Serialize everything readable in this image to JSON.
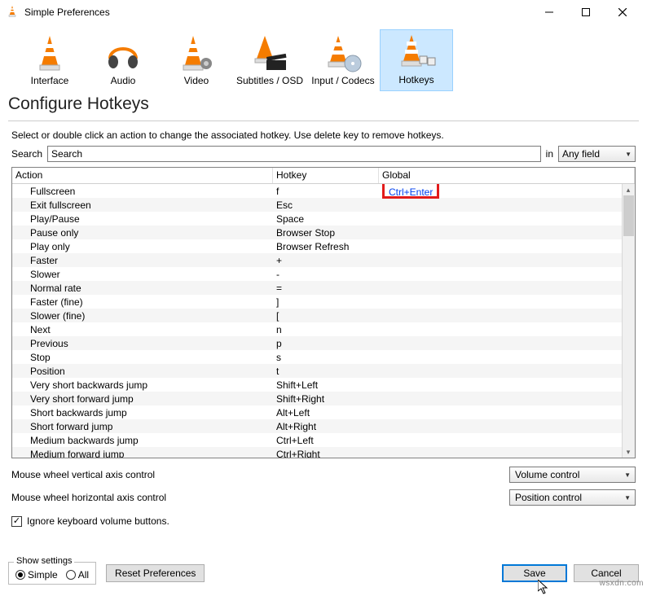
{
  "window": {
    "title": "Simple Preferences"
  },
  "categories": [
    {
      "label": "Interface"
    },
    {
      "label": "Audio"
    },
    {
      "label": "Video"
    },
    {
      "label": "Subtitles / OSD"
    },
    {
      "label": "Input / Codecs"
    },
    {
      "label": "Hotkeys"
    }
  ],
  "selected_category_index": 5,
  "heading": "Configure Hotkeys",
  "help_text": "Select or double click an action to change the associated hotkey. Use delete key to remove hotkeys.",
  "search": {
    "label": "Search",
    "value": "Search",
    "in_label": "in",
    "field": "Any field"
  },
  "columns": {
    "action": "Action",
    "hotkey": "Hotkey",
    "global": "Global"
  },
  "rows": [
    {
      "action": "Fullscreen",
      "hotkey": "f",
      "global": "Ctrl+Enter",
      "highlight_global": true
    },
    {
      "action": "Exit fullscreen",
      "hotkey": "Esc",
      "global": ""
    },
    {
      "action": "Play/Pause",
      "hotkey": "Space",
      "global": ""
    },
    {
      "action": "Pause only",
      "hotkey": "Browser Stop",
      "global": ""
    },
    {
      "action": "Play only",
      "hotkey": "Browser Refresh",
      "global": ""
    },
    {
      "action": "Faster",
      "hotkey": "+",
      "global": ""
    },
    {
      "action": "Slower",
      "hotkey": "-",
      "global": ""
    },
    {
      "action": "Normal rate",
      "hotkey": "=",
      "global": ""
    },
    {
      "action": "Faster (fine)",
      "hotkey": "]",
      "global": ""
    },
    {
      "action": "Slower (fine)",
      "hotkey": "[",
      "global": ""
    },
    {
      "action": "Next",
      "hotkey": "n",
      "global": ""
    },
    {
      "action": "Previous",
      "hotkey": "p",
      "global": ""
    },
    {
      "action": "Stop",
      "hotkey": "s",
      "global": ""
    },
    {
      "action": "Position",
      "hotkey": "t",
      "global": ""
    },
    {
      "action": "Very short backwards jump",
      "hotkey": "Shift+Left",
      "global": ""
    },
    {
      "action": "Very short forward jump",
      "hotkey": "Shift+Right",
      "global": ""
    },
    {
      "action": "Short backwards jump",
      "hotkey": "Alt+Left",
      "global": ""
    },
    {
      "action": "Short forward jump",
      "hotkey": "Alt+Right",
      "global": ""
    },
    {
      "action": "Medium backwards jump",
      "hotkey": "Ctrl+Left",
      "global": ""
    },
    {
      "action": "Medium forward jump",
      "hotkey": "Ctrl+Right",
      "global": ""
    }
  ],
  "mouse": {
    "vertical_label": "Mouse wheel vertical axis control",
    "vertical_value": "Volume control",
    "horizontal_label": "Mouse wheel horizontal axis control",
    "horizontal_value": "Position control",
    "ignore_kb_label": "Ignore keyboard volume buttons.",
    "ignore_kb_checked": true
  },
  "footer": {
    "show_settings_legend": "Show settings",
    "simple_label": "Simple",
    "all_label": "All",
    "selected_mode": "simple",
    "reset_label": "Reset Preferences",
    "save_label": "Save",
    "cancel_label": "Cancel"
  },
  "watermark": "wsxdn.com"
}
